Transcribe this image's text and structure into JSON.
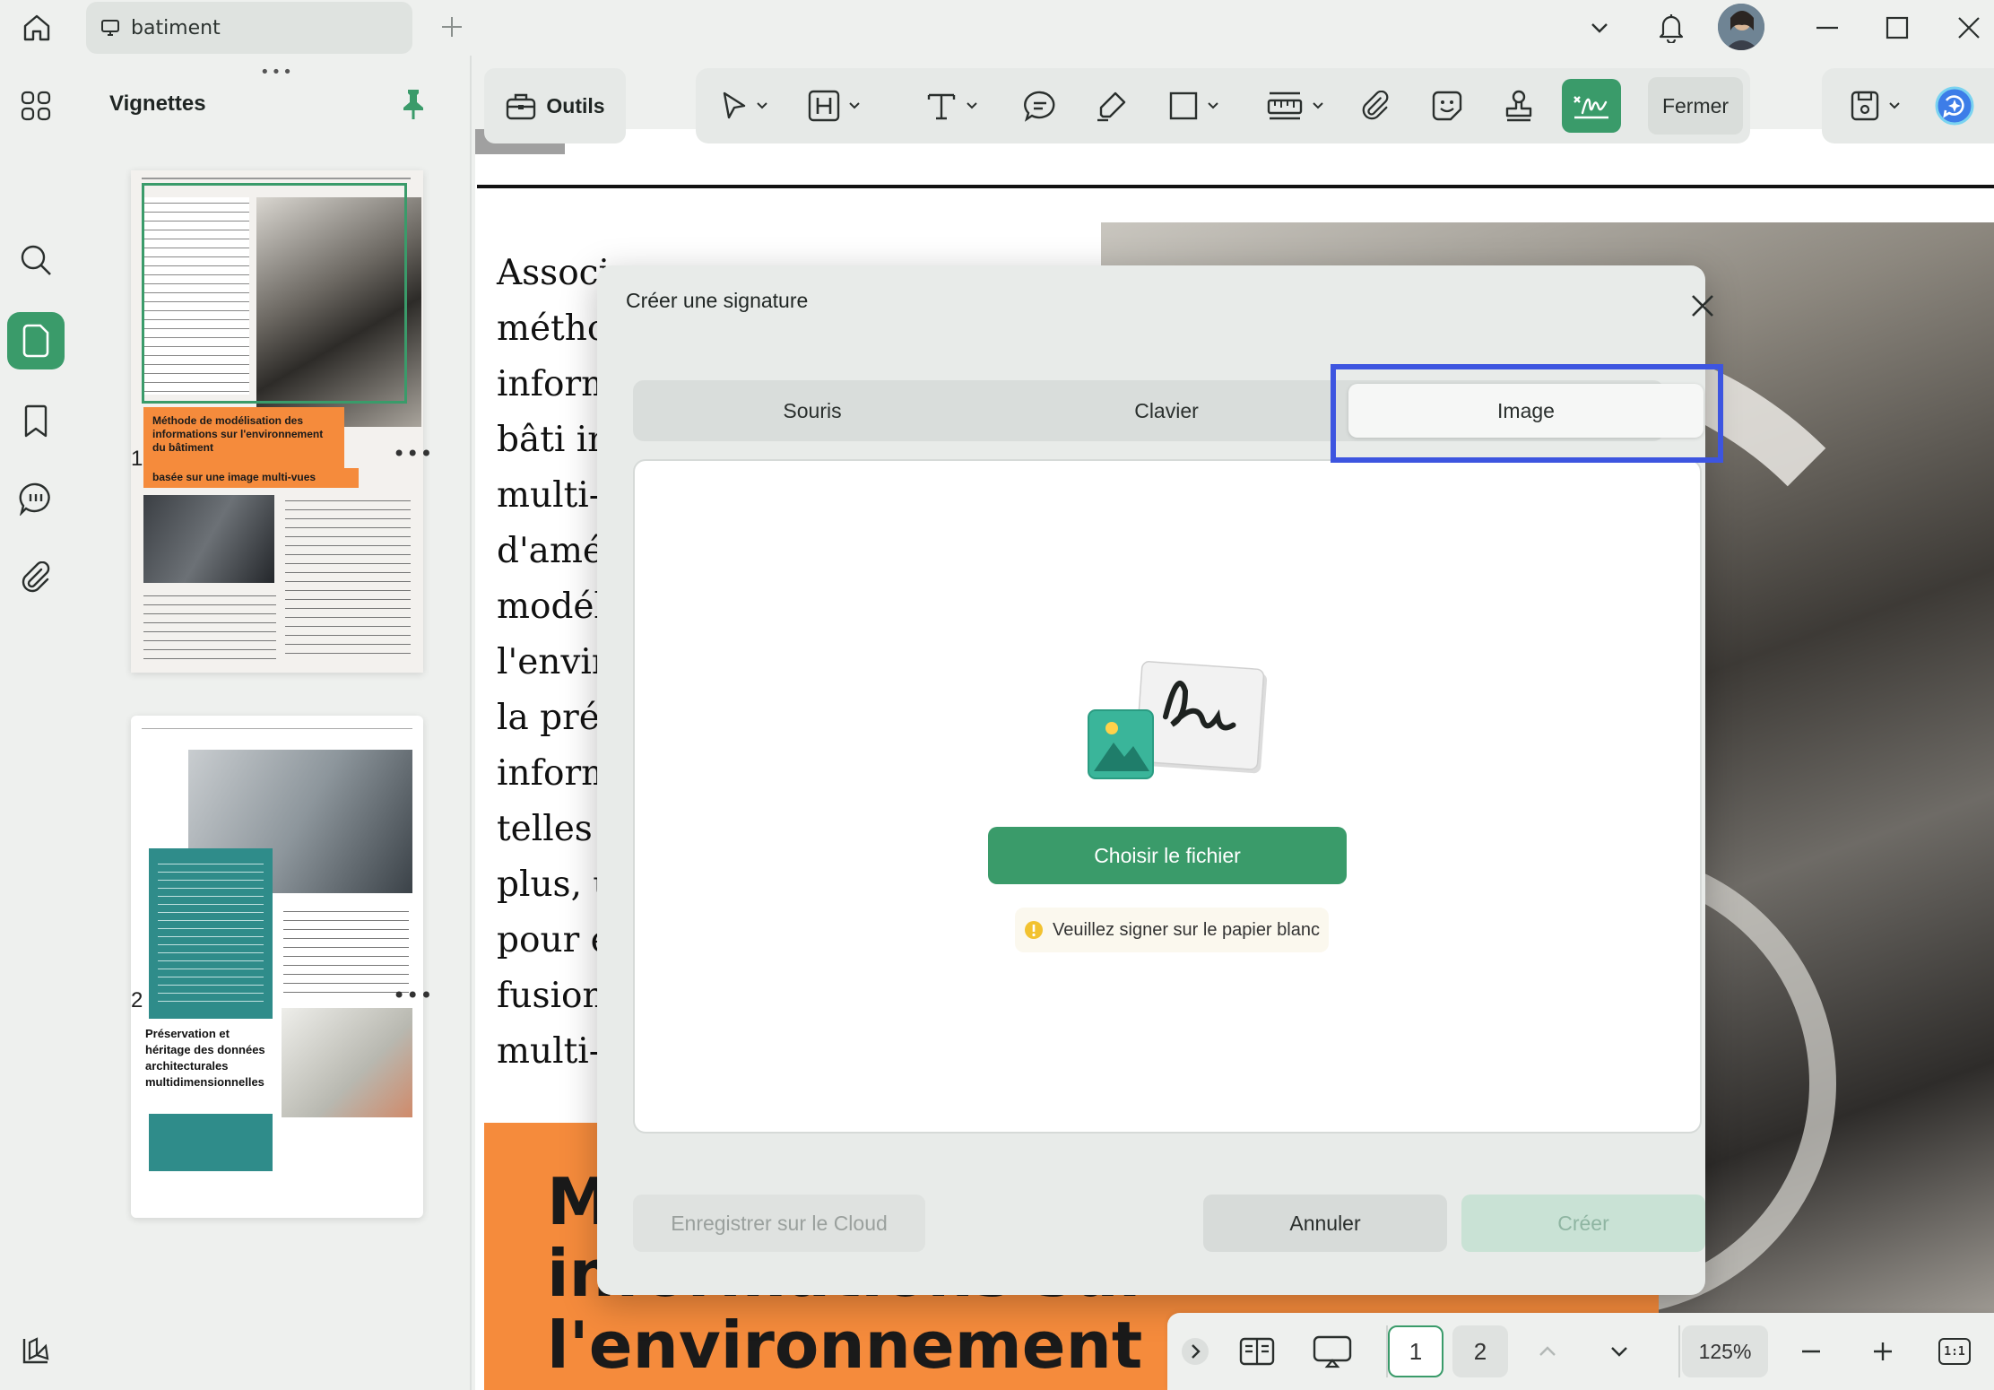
{
  "titlebar": {
    "tab_title": "batiment"
  },
  "thumbnails": {
    "title": "Vignettes",
    "pages": [
      {
        "number": "1",
        "highlight_title": "Méthode de modélisation des informations sur l'environnement du bâtiment",
        "highlight_sub": "basée sur une image multi-vues"
      },
      {
        "number": "2",
        "section_title": "Préservation et héritage des données architecturales multidimensionnelles"
      }
    ]
  },
  "document": {
    "body_lines": [
      "Associ",
      "métho",
      "inform",
      "bâti in",
      "multi-",
      "d'amél",
      "modél",
      "l'envir",
      "la préc",
      "inform",
      "telles c",
      "plus, u",
      "pour e",
      "fusion",
      "multi-"
    ],
    "headline": "Méthode de modélisation des\ninformations sur\nl'environnement du bâtiment"
  },
  "toolbar": {
    "outils_label": "Outils",
    "fermer_label": "Fermer"
  },
  "dialog": {
    "title": "Créer une signature",
    "tabs": [
      "Souris",
      "Clavier",
      "Image"
    ],
    "active_tab": "Image",
    "choose_file_label": "Choisir le fichier",
    "hint": "Veuillez signer sur le papier blanc",
    "cloud_label": "Enregistrer sur le Cloud",
    "cancel_label": "Annuler",
    "create_label": "Créer"
  },
  "bottombar": {
    "page_current": "1",
    "page_next": "2",
    "zoom": "125%",
    "actual_size_label": "1:1"
  },
  "colors": {
    "accent_green": "#3a9b6a",
    "highlight_blue": "#3d55e0",
    "doc_orange": "#f58b3c",
    "teal": "#2f8c8a"
  }
}
